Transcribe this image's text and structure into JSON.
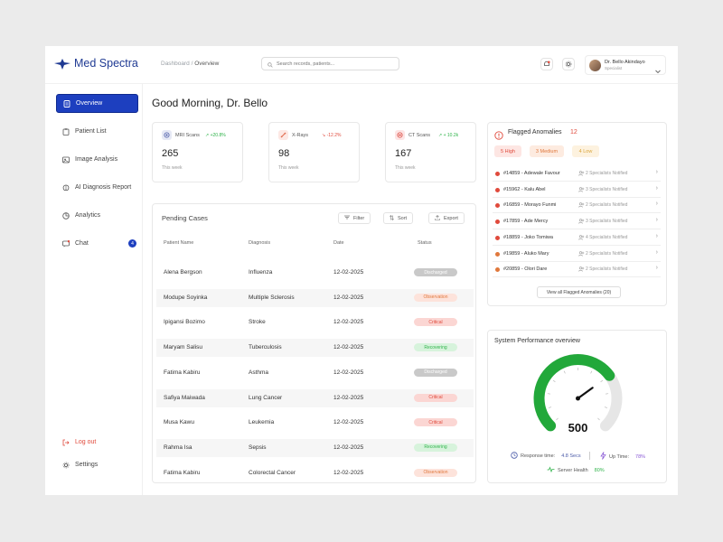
{
  "app": {
    "name": "Med Spectra"
  },
  "breadcrumb": {
    "root": "Dashboard",
    "separator": " / ",
    "current": "Overview"
  },
  "search": {
    "placeholder": "Search records, patients..."
  },
  "user": {
    "name": "Dr. Bello Akindayo",
    "role": "Specialist"
  },
  "sidebar": {
    "items": [
      {
        "label": "Overview",
        "icon": "overview-icon"
      },
      {
        "label": "Patient List",
        "icon": "clipboard-icon"
      },
      {
        "label": "Image Analysis",
        "icon": "image-icon"
      },
      {
        "label": "AI Diagnosis Report",
        "icon": "brain-icon"
      },
      {
        "label": "Analytics",
        "icon": "pie-chart-icon"
      },
      {
        "label": "Chat",
        "icon": "chat-icon",
        "badge": "4"
      }
    ],
    "logout": "Log out",
    "settings": "Settings"
  },
  "greeting": "Good Morning, Dr. Bello",
  "stats": [
    {
      "label": "MRI Scans",
      "change": "+20.8%",
      "value": "265",
      "sub": "This week",
      "trend": "up"
    },
    {
      "label": "X-Rays",
      "change": "-12.2%",
      "value": "98",
      "sub": "This week",
      "trend": "down"
    },
    {
      "label": "CT Scans",
      "change": "+ 10.2k",
      "value": "167",
      "sub": "This week",
      "trend": "up"
    }
  ],
  "pending": {
    "title": "Pending Cases",
    "filter": "Filter",
    "sort": "Sort",
    "export": "Export",
    "columns": [
      "Patient Name",
      "Diagnosis",
      "Date",
      "Status"
    ],
    "rows": [
      {
        "name": "Alena Bergson",
        "diagnosis": "Influenza",
        "date": "12-02-2025",
        "status": "Discharged"
      },
      {
        "name": "Modupe Soyinka",
        "diagnosis": "Multiple Sclerosis",
        "date": "12-02-2025",
        "status": "Observation"
      },
      {
        "name": "Ipigansi Bozimo",
        "diagnosis": "Stroke",
        "date": "12-02-2025",
        "status": "Critical"
      },
      {
        "name": "Maryam Salisu",
        "diagnosis": "Tuberculosis",
        "date": "12-02-2025",
        "status": "Recovering"
      },
      {
        "name": "Fatima Kabiru",
        "diagnosis": "Asthma",
        "date": "12-02-2025",
        "status": "Discharged"
      },
      {
        "name": "Safiya Maiwada",
        "diagnosis": "Lung Cancer",
        "date": "12-02-2025",
        "status": "Critical"
      },
      {
        "name": "Musa Kawu",
        "diagnosis": "Leukemia",
        "date": "12-02-2025",
        "status": "Critical"
      },
      {
        "name": "Rahma Isa",
        "diagnosis": "Sepsis",
        "date": "12-02-2025",
        "status": "Recovering"
      },
      {
        "name": "Fatima Kabiru",
        "diagnosis": "Colorectal Cancer",
        "date": "12-02-2025",
        "status": "Observation"
      }
    ]
  },
  "flagged": {
    "title": "Flagged Anomalies",
    "count": "12",
    "tags": [
      "5 High",
      "3 Medium",
      "4 Low"
    ],
    "rows": [
      {
        "id": "#14859 - Adewale Favour",
        "note": "2 Specialists Notified",
        "level": "high"
      },
      {
        "id": "#15962 - Kalu Abel",
        "note": "3 Specialists Notified",
        "level": "high"
      },
      {
        "id": "#16859 - Morayo Funmi",
        "note": "2 Specialists Notified",
        "level": "high"
      },
      {
        "id": "#17859 - Ade Mercy",
        "note": "3 Specialists Notified",
        "level": "high"
      },
      {
        "id": "#18859 - Joko Tomiwa",
        "note": "4 Specialists Notified",
        "level": "high"
      },
      {
        "id": "#19859 - Aluko Mary",
        "note": "2 Specialists Notified",
        "level": "medium"
      },
      {
        "id": "#20859 - Olori Dare",
        "note": "2 Specialists Notified",
        "level": "medium"
      }
    ],
    "view_all": "View all Flagged Anomalies (20)"
  },
  "performance": {
    "title": "System Performance overview",
    "gauge_value": "500",
    "gauge_fraction": 0.7,
    "response_label": "Response time:",
    "response_value": "4.8 Secs",
    "uptime_label": "Up Time:",
    "uptime_value": "78%",
    "health_label": "Server Health",
    "health_value": "80%"
  },
  "colors": {
    "brand": "#1d3fbf",
    "critical": "#e04a3c",
    "recovering": "#2fb34a",
    "gauge": "#22a83a"
  }
}
